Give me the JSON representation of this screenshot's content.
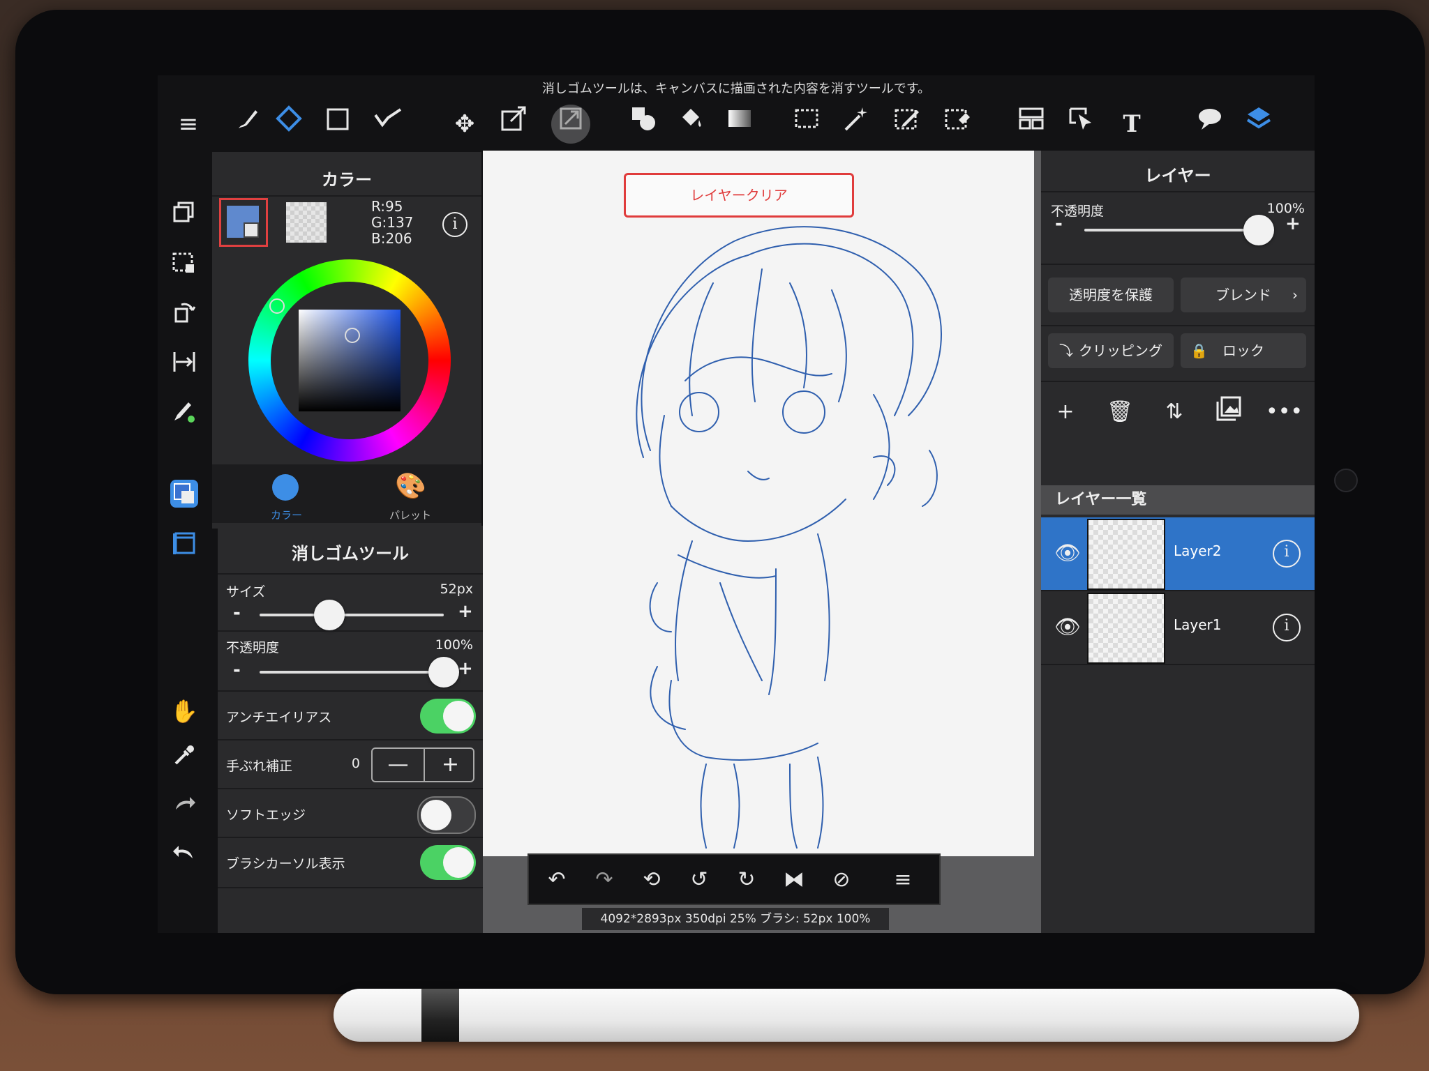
{
  "status_bar": {
    "hint": "消しゴムツールは、キャンバスに描画された内容を消すツールです。"
  },
  "colors": {
    "accent": "#3d8ee6",
    "selected_layer": "#2f74c8",
    "toggle_on": "#4bd264",
    "clear_button": "#e03c3c",
    "foreground": "#5F89CE"
  },
  "top_toolbar": {
    "icons": [
      "menu-icon",
      "brush-icon",
      "eraser-icon",
      "rectangle-icon",
      "smudge-icon",
      "move-icon",
      "transform-icon",
      "free-transform-icon",
      "shape-icon",
      "bucket-icon",
      "gradient-icon",
      "select-rect-icon",
      "magic-wand-icon",
      "select-pen-icon",
      "select-eraser-icon",
      "frame-divide-icon",
      "operation-icon",
      "text-icon",
      "speech-bubble-icon",
      "layers-icon"
    ]
  },
  "left_toolbar": {
    "icons": [
      "layer-duplicate-icon",
      "deselect-icon",
      "rotate-canvas-icon",
      "snap-icon",
      "brush-select-icon",
      "color-icon",
      "panel-icon",
      "hand-icon",
      "eyedropper-icon",
      "redo-icon",
      "undo-icon"
    ]
  },
  "color_panel": {
    "title": "カラー",
    "r": "R:95",
    "g": "G:137",
    "b": "B:206",
    "tab_color": "カラー",
    "tab_palette": "パレット"
  },
  "tool_panel": {
    "title": "消しゴムツール",
    "size_label": "サイズ",
    "size_value": "52px",
    "size_level": 0.38,
    "opacity_label": "不透明度",
    "opacity_value": "100%",
    "opacity_level": 1.0,
    "antialias_label": "アンチエイリアス",
    "antialias_on": true,
    "stabilizer_label": "手ぶれ補正",
    "stabilizer_value": "0",
    "stabilizer_minus": "—",
    "stabilizer_plus": "+",
    "soft_edge_label": "ソフトエッジ",
    "soft_edge_on": false,
    "brush_cursor_label": "ブラシカーソル表示",
    "brush_cursor_on": true,
    "minus": "-",
    "plus": "+"
  },
  "canvas": {
    "clear_button_label": "レイヤークリア",
    "info": "4092*2893px 350dpi 25% ブラシ: 52px 100%"
  },
  "bottom_toolbar": {
    "icons": [
      "undo-icon",
      "redo-icon",
      "rotate-lasso-icon",
      "rotate-left-icon",
      "rotate-right-icon",
      "flip-icon",
      "reset-rotation-icon",
      "menu-icon"
    ]
  },
  "layer_panel": {
    "title": "レイヤー",
    "opacity_label": "不透明度",
    "opacity_value": "100%",
    "opacity_level": 1.0,
    "protect_alpha_label": "透明度を保護",
    "blend_label": "ブレンド",
    "clipping_label": "クリッピング",
    "lock_label": "ロック",
    "list_header": "レイヤー一覧",
    "minus": "-",
    "plus": "+",
    "layers": [
      {
        "name": "Layer2",
        "selected": true
      },
      {
        "name": "Layer1",
        "selected": false
      }
    ]
  }
}
